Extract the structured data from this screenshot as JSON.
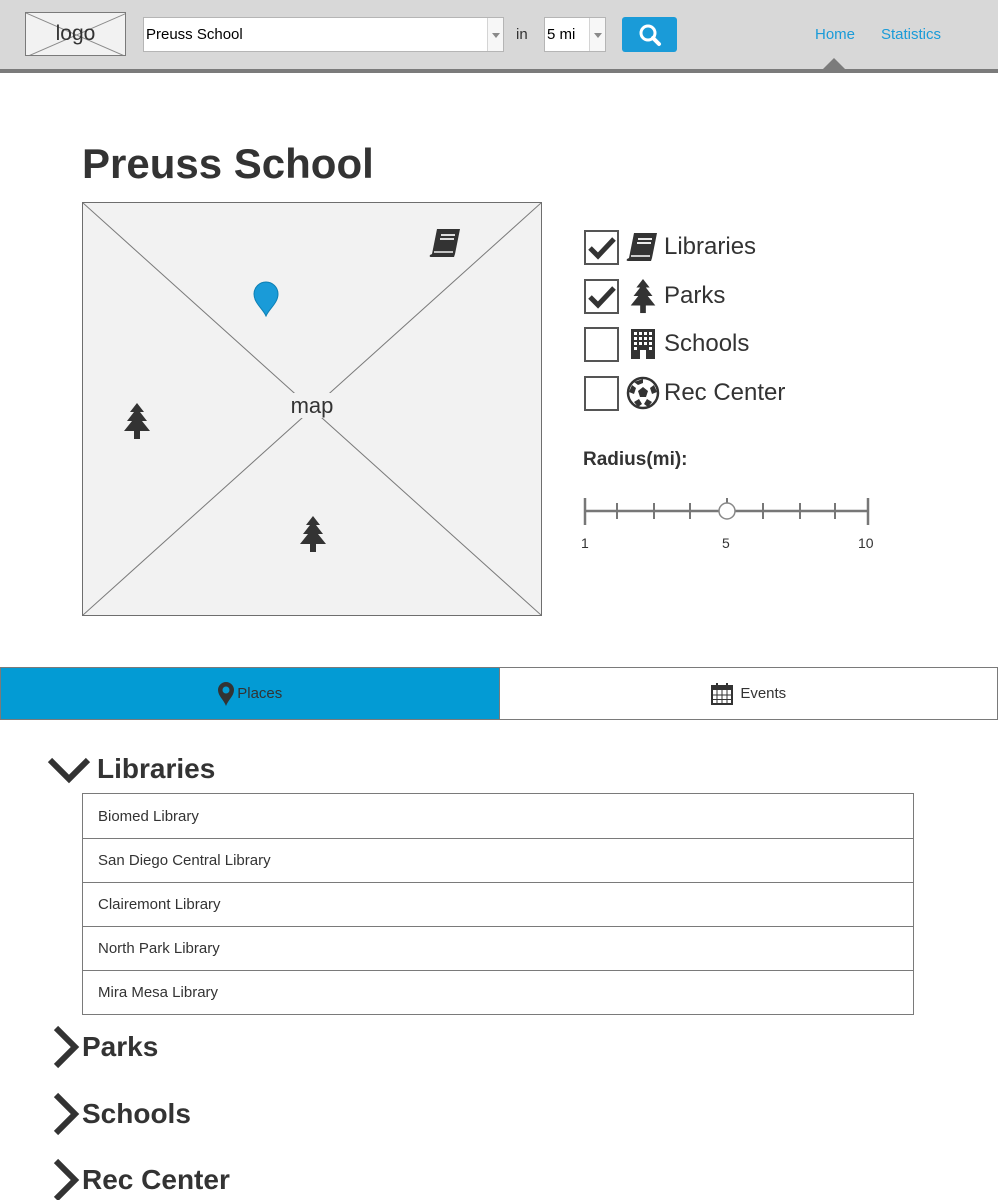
{
  "header": {
    "logo_text": "logo",
    "search": {
      "value": "Preuss School"
    },
    "in_label": "in",
    "radius_select": {
      "value": "5 mi"
    },
    "nav": {
      "home": "Home",
      "statistics": "Statistics"
    }
  },
  "page_title": "Preuss School",
  "map": {
    "label": "map",
    "markers": [
      "book-icon",
      "map-pin-icon",
      "tree-icon",
      "tree-icon"
    ]
  },
  "filters": [
    {
      "label": "Libraries",
      "checked": true,
      "icon": "book-icon"
    },
    {
      "label": "Parks",
      "checked": true,
      "icon": "tree-icon"
    },
    {
      "label": "Schools",
      "checked": false,
      "icon": "building-icon"
    },
    {
      "label": "Rec Center",
      "checked": false,
      "icon": "soccer-ball-icon"
    }
  ],
  "radius": {
    "title": "Radius(mi):",
    "min_label": "1",
    "mid_label": "5",
    "max_label": "10",
    "value": 5
  },
  "tabs": {
    "places": "Places",
    "events": "Events",
    "active": "places"
  },
  "accordion": {
    "libraries": {
      "title": "Libraries",
      "expanded": true,
      "items": [
        "Biomed Library",
        "San Diego Central Library",
        "Clairemont Library",
        "North Park Library",
        "Mira Mesa Library"
      ]
    },
    "parks": {
      "title": "Parks",
      "expanded": false
    },
    "schools": {
      "title": "Schools",
      "expanded": false
    },
    "rec_center": {
      "title": "Rec Center",
      "expanded": false
    }
  },
  "colors": {
    "accent": "#1a9bd8",
    "tab_active": "#039bd4",
    "topbar": "#d8d8d8",
    "text": "#333333"
  }
}
